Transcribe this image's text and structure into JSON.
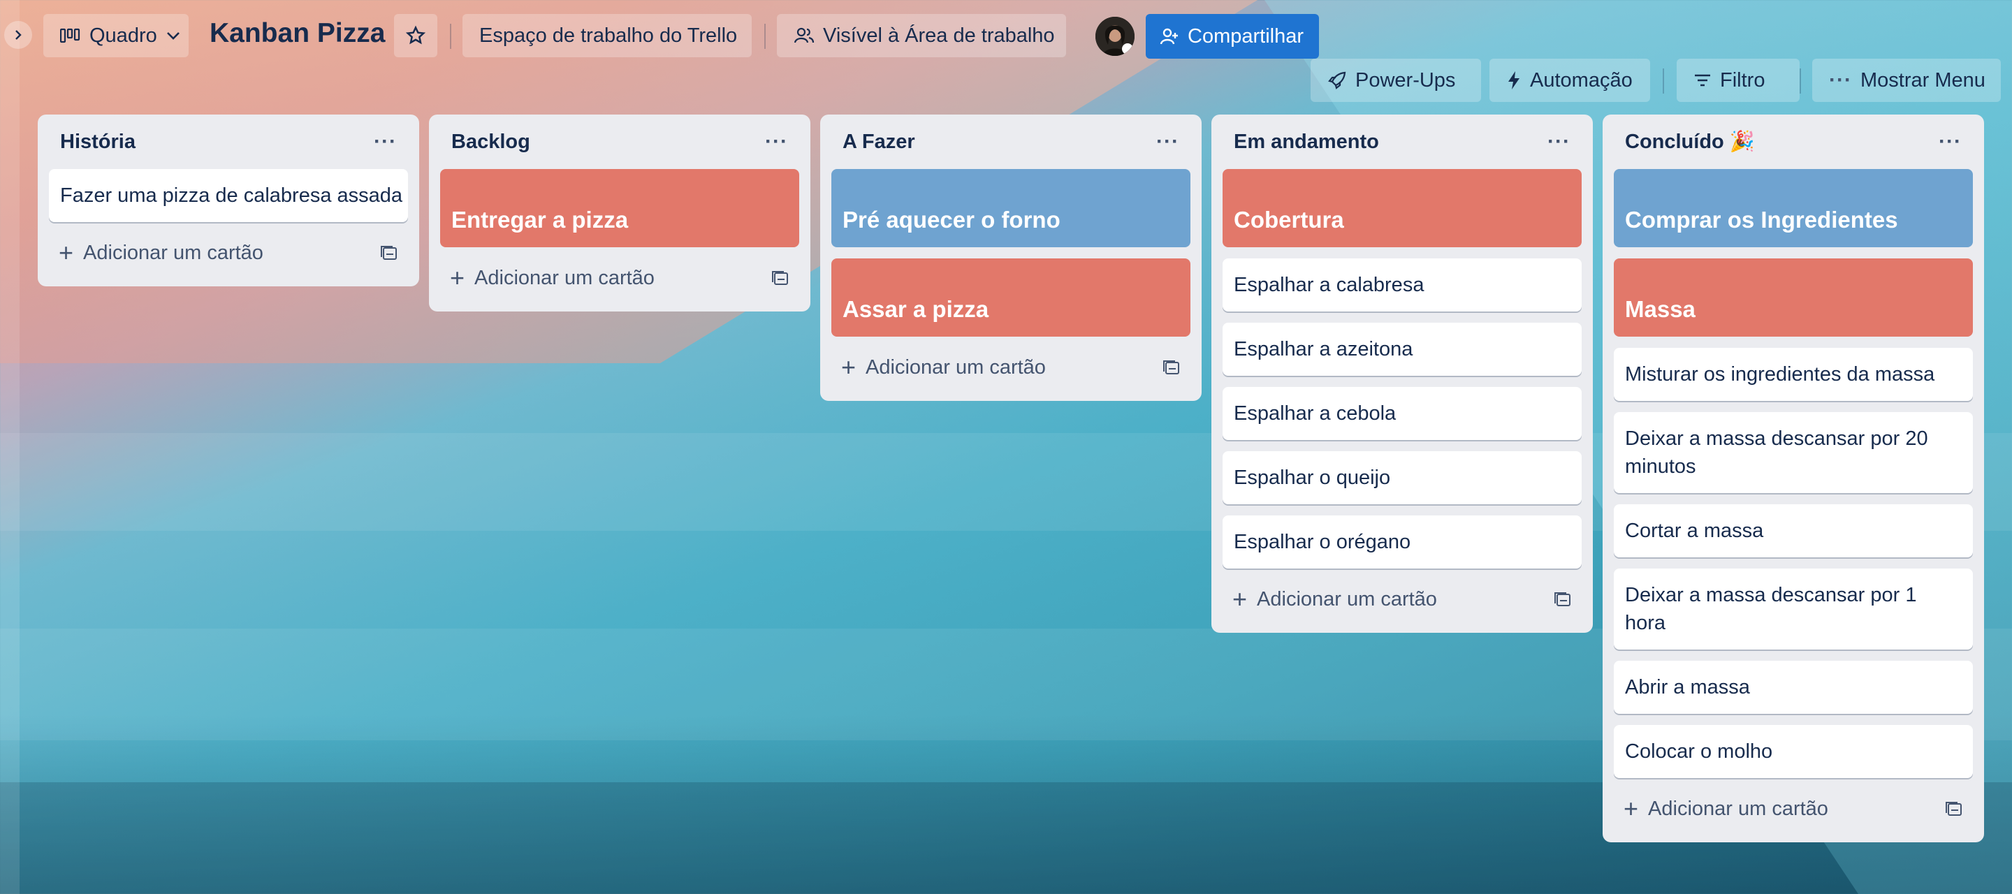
{
  "colors": {
    "share": "#1f74d1",
    "cover_orange": "#e2786a",
    "cover_blue": "#6fa3d0",
    "list_bg": "#ebecf0"
  },
  "header": {
    "view_label": "Quadro",
    "board_title": "Kanban Pizza",
    "workspace": "Espaço de trabalho do Trello",
    "visibility": "Visível à Área de trabalho",
    "share_label": "Compartilhar",
    "powerups": "Power-Ups",
    "automation": "Automação",
    "filter": "Filtro",
    "menu": "Mostrar Menu"
  },
  "add_card_label": "Adicionar um cartão",
  "lists": [
    {
      "title": "História",
      "cards": [
        {
          "text": "Fazer uma pizza de calabresa assada"
        }
      ]
    },
    {
      "title": "Backlog",
      "covers": [
        {
          "text": "Entregar a pizza",
          "color": "orange"
        }
      ]
    },
    {
      "title": "A Fazer",
      "covers": [
        {
          "text": "Pré aquecer o forno",
          "color": "blue"
        },
        {
          "text": "Assar a pizza",
          "color": "orange"
        }
      ]
    },
    {
      "title": "Em andamento",
      "covers": [
        {
          "text": "Cobertura",
          "color": "orange"
        }
      ],
      "cards": [
        {
          "text": "Espalhar a calabresa"
        },
        {
          "text": "Espalhar a azeitona"
        },
        {
          "text": "Espalhar a cebola"
        },
        {
          "text": "Espalhar o queijo"
        },
        {
          "text": "Espalhar o orégano"
        }
      ]
    },
    {
      "title": "Concluído 🎉",
      "covers": [
        {
          "text": "Comprar os Ingredientes",
          "color": "blue"
        },
        {
          "text": "Massa",
          "color": "orange"
        }
      ],
      "cards": [
        {
          "text": "Misturar os ingredientes da massa"
        },
        {
          "text": "Deixar a massa descansar por 20 minutos"
        },
        {
          "text": "Cortar a massa"
        },
        {
          "text": "Deixar a massa descansar por 1 hora"
        },
        {
          "text": "Abrir a massa"
        },
        {
          "text": "Colocar o molho"
        }
      ]
    }
  ]
}
